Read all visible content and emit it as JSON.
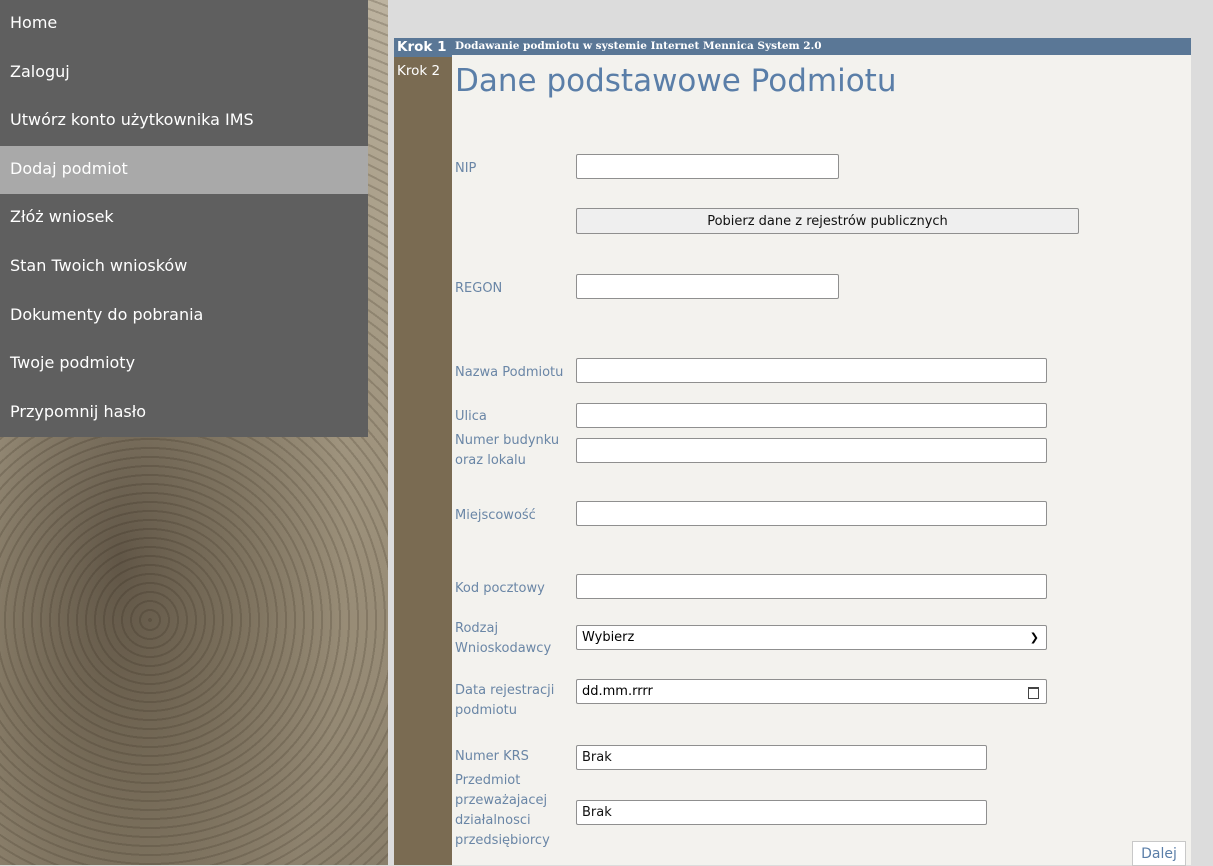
{
  "nav": {
    "items": [
      {
        "label": "Home"
      },
      {
        "label": "Zaloguj"
      },
      {
        "label": "Utwórz konto użytkownika IMS"
      },
      {
        "label": "Dodaj podmiot"
      },
      {
        "label": "Złóż wniosek"
      },
      {
        "label": "Stan Twoich wniosków"
      },
      {
        "label": "Dokumenty do pobrania"
      },
      {
        "label": "Twoje podmioty"
      },
      {
        "label": "Przypomnij hasło"
      }
    ],
    "active": "Dodaj podmiot"
  },
  "steps": {
    "step1": "Krok 1",
    "step2": "Krok 2"
  },
  "header": {
    "banner": "Dodawanie podmiotu w systemie Internet Mennica System 2.0",
    "title": "Dane podstawowe Podmiotu"
  },
  "form": {
    "nip_label": "NIP",
    "fetch_button": "Pobierz dane z rejestrów publicznych",
    "regon_label": "REGON",
    "name_label": "Nazwa Podmiotu",
    "street_label": "Ulica",
    "building_label": "Numer budynku oraz lokalu",
    "city_label": "Miejscowość",
    "postal_label": "Kod pocztowy",
    "applicant_type_label": "Rodzaj Wnioskodawcy",
    "applicant_type_value": "Wybierz",
    "reg_date_label": "Data rejestracji podmiotu",
    "reg_date_placeholder": "dd.mm.rrrr",
    "krs_label": "Numer KRS",
    "krs_value": "Brak",
    "activity_label": "Przedmiot przeważajacej działalnosci przedsiębiorcy",
    "activity_value": "Brak",
    "next_button": "Dalej"
  }
}
